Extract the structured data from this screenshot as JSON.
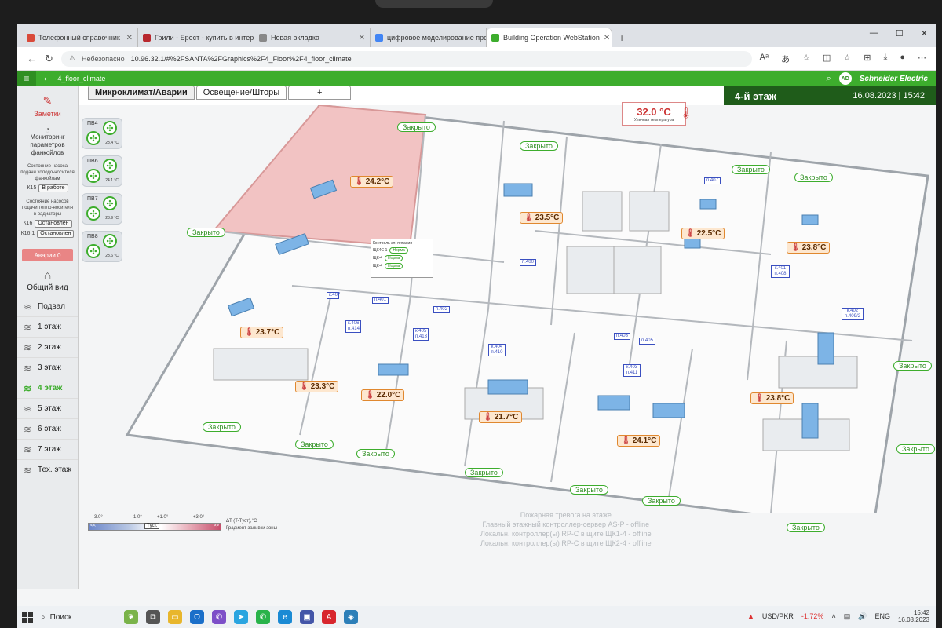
{
  "browser": {
    "tabs": [
      {
        "label": "Телефонный справочник",
        "color": "#d94a3a"
      },
      {
        "label": "Грили - Брест - купить в интерн",
        "color": "#b8282e"
      },
      {
        "label": "Новая вкладка",
        "color": "#888888"
      },
      {
        "label": "цифровое моделирование про",
        "color": "#4285f4"
      },
      {
        "label": "Building Operation WebStation",
        "color": "#3dad2d"
      }
    ],
    "new_tab": "+",
    "url_warning": "Небезопасно",
    "url": "10.96.32.1/#%2FSANTA%2FGraphics%2F4_Floor%2F4_floor_climate"
  },
  "app": {
    "breadcrumb": "4_floor_climate",
    "tabs": [
      "Микроклимат/Аварии",
      "Освещение/Шторы",
      "+"
    ],
    "floor_title": "4-й этаж",
    "date": "16.08.2023",
    "time": "15:42",
    "avatar": "AD",
    "brand": "Schneider Electric"
  },
  "sidebar": {
    "notes": "Заметки",
    "monitoring": "Мониторинг параметров фанкойлов",
    "pump_cold": "Состояние насоса подачи холодо-носителя фанкойлам",
    "pump_cold_id": "К15",
    "pump_cold_state": "В работе",
    "pump_heat": "Состояние насосов подачи тепло-носителя в радиаторы",
    "pump_heat_rows": [
      {
        "id": "К16",
        "state": "Остановлен"
      },
      {
        "id": "К16.1",
        "state": "Остановлен"
      }
    ],
    "alarms": "Аварии 0",
    "overview": "Общий вид",
    "floors": [
      "Подвал",
      "1 этаж",
      "2 этаж",
      "3 этаж",
      "4 этаж",
      "5 этаж",
      "6 этаж",
      "7 этаж",
      "Тех. этаж"
    ],
    "active_floor": "4 этаж"
  },
  "vents": [
    {
      "name": "ПВ4",
      "temp": "23.4 °C"
    },
    {
      "name": "ПВ6",
      "temp": "24.1 °C"
    },
    {
      "name": "ПВ7",
      "temp": "23.9 °C"
    },
    {
      "name": "ПВ8",
      "temp": "23.6 °C"
    }
  ],
  "outdoor": {
    "value": "32.0 °C",
    "label": "Уличная температура"
  },
  "zones": [
    "24.2°C",
    "23.5°C",
    "22.5°C",
    "23.8°C",
    "23.7°C",
    "23.3°C",
    "22.0°C",
    "21.7°C",
    "24.1°C",
    "23.8°C"
  ],
  "closed_label": "Закрыто",
  "rooms": [
    "п.407",
    "п.400",
    "п.401",
    "п.402",
    "к.401 п.408",
    "к.402 п.409/2",
    "к.407",
    "к.406 п.414",
    "к.405 п.413",
    "к.404 п.410",
    "к.403 п.411",
    "п.403",
    "п.405"
  ],
  "power_panel": {
    "title": "Контроль эл. питания",
    "rows": [
      {
        "id": "ЩК4С-1",
        "state": "Норма"
      },
      {
        "id": "ЩК-4",
        "state": "Норма"
      },
      {
        "id": "ЩК-4",
        "state": "Норма"
      }
    ]
  },
  "legend": {
    "ticks": [
      "-3.0°",
      "-1.0°",
      "+1.0°",
      "+3.0°"
    ],
    "center": "Tуст.",
    "left_cap": "<<",
    "right_cap": ">>",
    "title": "ΔT (T-Tуст),°C",
    "subtitle": "Градиент заливки зоны"
  },
  "status_lines": [
    "Пожарная тревога на этаже",
    "Главный этажный контроллер-сервер AS-P - offline",
    "Локальн. контроллер(ы) RP-C в щите ЩК1-4 - offline",
    "Локальн. контроллер(ы) RP-C в щите ЩК2-4 - offline"
  ],
  "taskbar": {
    "search": "Поиск",
    "currency": "USD/PKR",
    "currency_change": "-1.72%",
    "lang": "ENG",
    "time": "15:42",
    "date": "16.08.2023"
  }
}
